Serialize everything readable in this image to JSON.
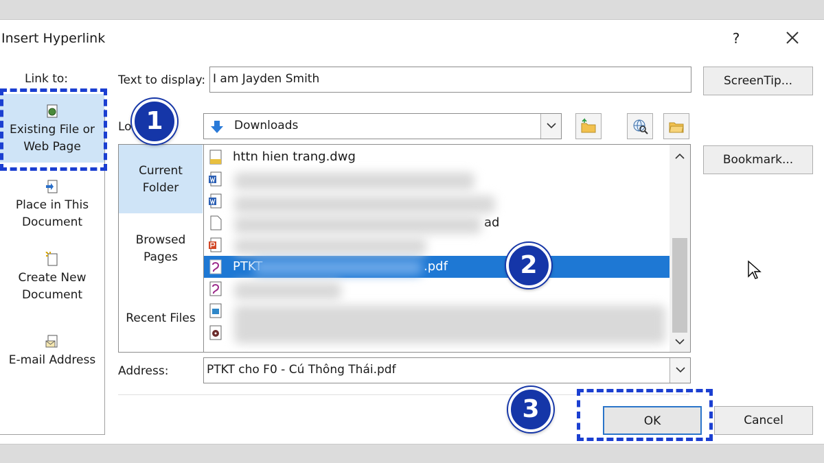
{
  "dialog": {
    "title": "Insert Hyperlink",
    "help_label": "?",
    "close_icon": "close-icon"
  },
  "link_to": {
    "header": "Link to:",
    "items": [
      {
        "label_line1": "Existing File or",
        "label_line2": "Web Page",
        "icon": "file-globe-icon",
        "selected": true
      },
      {
        "label_line1": "Place in This",
        "label_line2": "Document",
        "icon": "document-place-icon",
        "selected": false
      },
      {
        "label_line1": "Create New",
        "label_line2": "Document",
        "icon": "new-document-icon",
        "selected": false
      },
      {
        "label_line1": "E-mail Address",
        "label_line2": "",
        "icon": "email-icon",
        "selected": false
      }
    ]
  },
  "text_to_display": {
    "label": "Text to display:",
    "value": "I am Jayden Smith"
  },
  "look_in": {
    "label": "Lo",
    "value": "Downloads",
    "icon": "download-arrow-icon"
  },
  "toolbar_icons": [
    "folder-up-icon",
    "browse-web-icon",
    "browse-file-icon"
  ],
  "buttons": {
    "screentip": "ScreenTip...",
    "bookmark": "Bookmark...",
    "ok": "OK",
    "cancel": "Cancel"
  },
  "browse_sidebar": {
    "items": [
      {
        "line1": "Current",
        "line2": "Folder",
        "selected": true
      },
      {
        "line1": "Browsed",
        "line2": "Pages",
        "selected": false
      },
      {
        "line1": "Recent Files",
        "line2": "",
        "selected": false
      }
    ]
  },
  "files": [
    {
      "name": "httn hien trang.dwg",
      "icon": "dwg-file-icon",
      "selected": false
    },
    {
      "name": "",
      "icon": "word-file-icon",
      "selected": false
    },
    {
      "name": "",
      "icon": "word-file-icon",
      "selected": false
    },
    {
      "name": "ad",
      "icon": "blank-file-icon",
      "selected": false
    },
    {
      "name": "",
      "icon": "powerpoint-file-icon",
      "selected": false
    },
    {
      "name": "PTKT",
      "name_suffix": ".pdf",
      "icon": "pdf-file-icon",
      "selected": true
    },
    {
      "name": "",
      "icon": "pdf-file-icon",
      "selected": false
    },
    {
      "name": "",
      "icon": "image-file-icon",
      "selected": false
    },
    {
      "name": "",
      "icon": "audio-file-icon",
      "selected": false
    }
  ],
  "address": {
    "label": "Address:",
    "value": "PTKT cho F0 - Cú Thông Thái.pdf"
  },
  "step_markers": [
    "1",
    "2",
    "3"
  ],
  "colors": {
    "selection_blue": "#1e78d4",
    "marker_blue": "#1536a8",
    "dash_blue": "#1b3fd1",
    "light_selection": "#cfe4f7"
  }
}
